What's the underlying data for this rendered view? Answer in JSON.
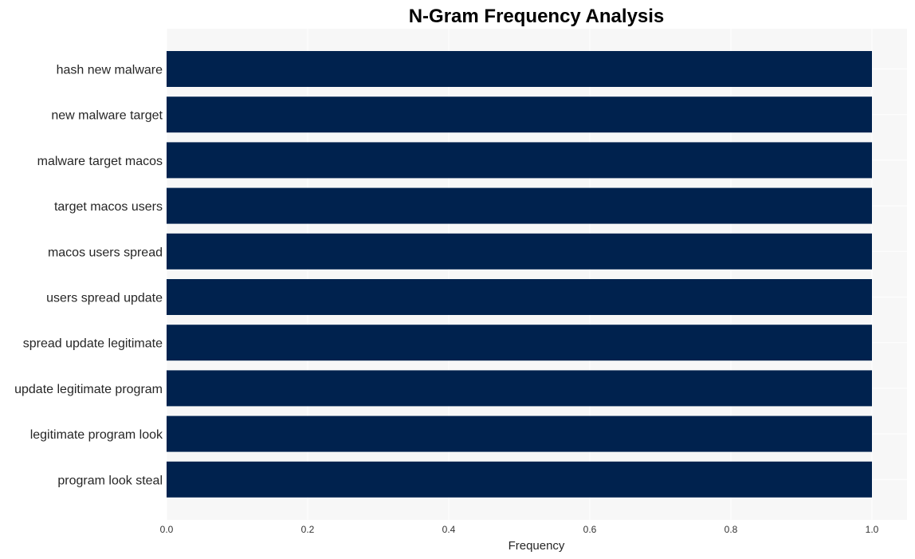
{
  "chart_data": {
    "type": "bar",
    "orientation": "horizontal",
    "title": "N-Gram Frequency Analysis",
    "xlabel": "Frequency",
    "ylabel": "",
    "categories": [
      "hash new malware",
      "new malware target",
      "malware target macos",
      "target macos users",
      "macos users spread",
      "users spread update",
      "spread update legitimate",
      "update legitimate program",
      "legitimate program look",
      "program look steal"
    ],
    "values": [
      1,
      1,
      1,
      1,
      1,
      1,
      1,
      1,
      1,
      1
    ],
    "xlim": [
      0,
      1.05
    ],
    "xticks": [
      0.0,
      0.2,
      0.4,
      0.6,
      0.8,
      1.0
    ],
    "xtick_labels": [
      "0.0",
      "0.2",
      "0.4",
      "0.6",
      "0.8",
      "1.0"
    ],
    "grid": true,
    "legend": "none",
    "colors": {
      "bar": "#00224e",
      "plot_background": "#f7f7f7",
      "grid": "#ffffff"
    }
  }
}
